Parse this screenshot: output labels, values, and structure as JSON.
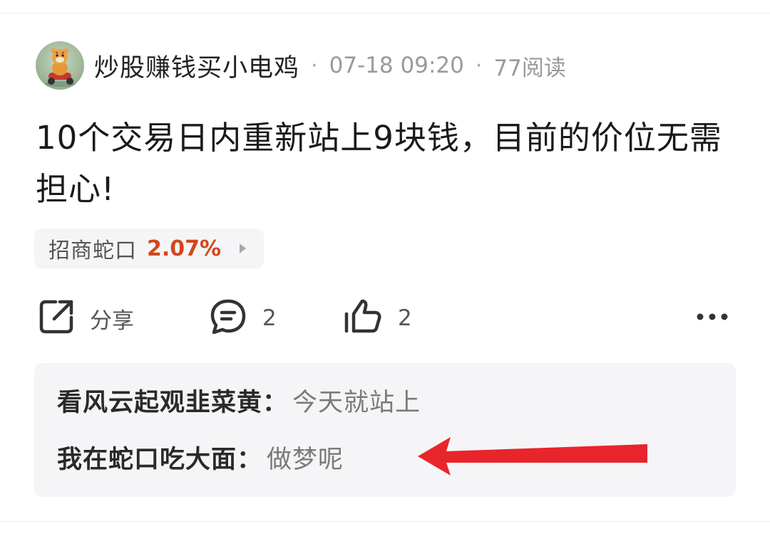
{
  "post": {
    "author": "炒股赚钱买小电鸡",
    "separator": "·",
    "time": "07-18 09:20",
    "reads": "77阅读",
    "title": "10个交易日内重新站上9块钱，目前的价位无需担心!"
  },
  "stock_tag": {
    "name": "招商蛇口",
    "change": "2.07%",
    "change_color": "#d2471c"
  },
  "actions": {
    "share_label": "分享",
    "comment_count": "2",
    "like_count": "2",
    "icons": [
      "share-icon",
      "comment-icon",
      "thumbs-up-icon",
      "more-icon"
    ]
  },
  "comments": [
    {
      "user": "看风云起观韭菜黄",
      "colon": "：",
      "text": "今天就站上"
    },
    {
      "user": "我在蛇口吃大面",
      "colon": "：",
      "text": "做梦呢"
    }
  ],
  "annotation": {
    "arrow_color": "#e8252b"
  }
}
